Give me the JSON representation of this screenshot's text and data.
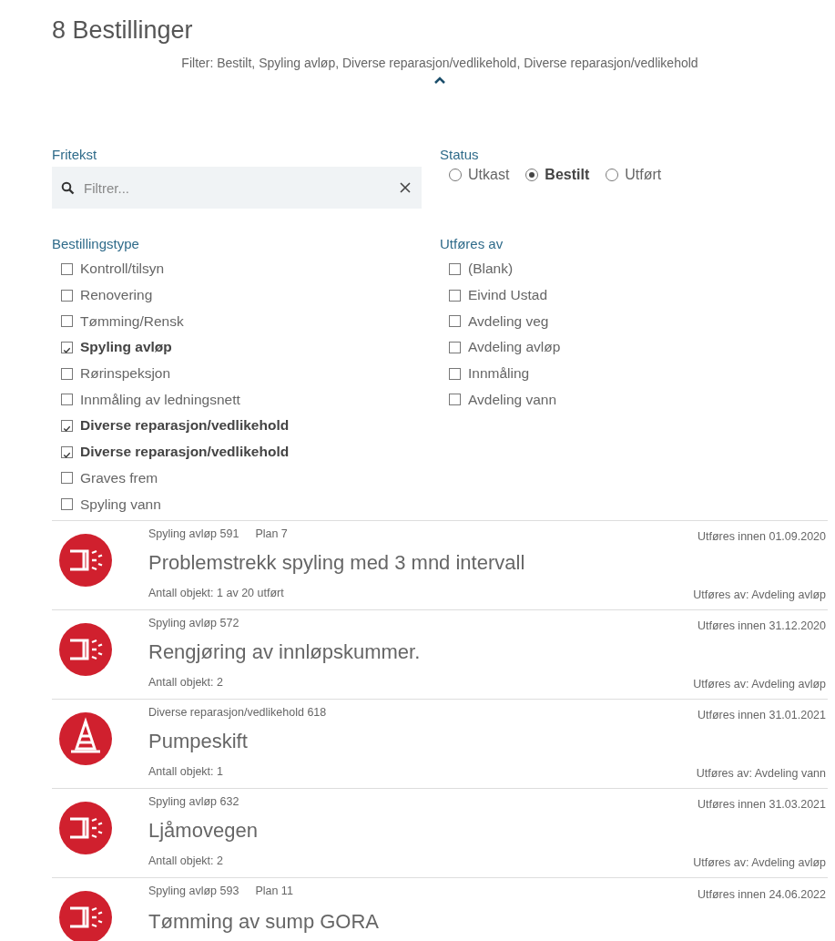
{
  "header": {
    "title": "8 Bestillinger",
    "filter_summary": "Filter: Bestilt, Spyling avløp, Diverse reparasjon/vedlikehold, Diverse reparasjon/vedlikehold",
    "expanded": true
  },
  "search": {
    "label": "Fritekst",
    "placeholder": "Filtrer..."
  },
  "status": {
    "label": "Status",
    "options": [
      {
        "label": "Utkast",
        "selected": false
      },
      {
        "label": "Bestilt",
        "selected": true
      },
      {
        "label": "Utført",
        "selected": false
      }
    ]
  },
  "order_types": {
    "label": "Bestillingstype",
    "items": [
      {
        "label": "Kontroll/tilsyn",
        "checked": false
      },
      {
        "label": "Renovering",
        "checked": false
      },
      {
        "label": "Tømming/Rensk",
        "checked": false
      },
      {
        "label": "Spyling avløp",
        "checked": true
      },
      {
        "label": "Rørinspeksjon",
        "checked": false
      },
      {
        "label": "Innmåling av ledningsnett",
        "checked": false
      },
      {
        "label": "Diverse reparasjon/vedlikehold",
        "checked": true
      },
      {
        "label": "Diverse reparasjon/vedlikehold",
        "checked": true
      },
      {
        "label": "Graves frem",
        "checked": false
      },
      {
        "label": "Spyling vann",
        "checked": false
      }
    ]
  },
  "performed_by": {
    "label": "Utføres av",
    "items": [
      {
        "label": "(Blank)",
        "checked": false
      },
      {
        "label": "Eivind Ustad",
        "checked": false
      },
      {
        "label": "Avdeling veg",
        "checked": false
      },
      {
        "label": "Avdeling avløp",
        "checked": false
      },
      {
        "label": "Innmåling",
        "checked": false
      },
      {
        "label": "Avdeling vann",
        "checked": false
      }
    ]
  },
  "orders": [
    {
      "kind": "flush",
      "type_number": "Spyling avløp 591",
      "plan": "Plan 7",
      "due": "Utføres innen 01.09.2020",
      "title": "Problemstrekk spyling med 3 mnd intervall",
      "count": "Antall objekt: 1 av 20 utført",
      "performer": "Utføres av: Avdeling avløp"
    },
    {
      "kind": "flush",
      "type_number": "Spyling avløp 572",
      "due": "Utføres innen 31.12.2020",
      "title": "Rengjøring av innløpskummer.",
      "count": "Antall objekt: 2",
      "performer": "Utføres av: Avdeling avløp"
    },
    {
      "kind": "cone",
      "type_number": "Diverse reparasjon/vedlikehold 618",
      "due": "Utføres innen 31.01.2021",
      "title": "Pumpeskift",
      "count": "Antall objekt: 1",
      "performer": "Utføres av: Avdeling vann"
    },
    {
      "kind": "flush",
      "type_number": "Spyling avløp 632",
      "due": "Utføres innen 31.03.2021",
      "title": "Ljåmovegen",
      "count": "Antall objekt: 2",
      "performer": "Utføres av: Avdeling avløp"
    },
    {
      "kind": "flush",
      "type_number": "Spyling avløp 593",
      "plan": "Plan 11",
      "due": "Utføres innen 24.06.2022",
      "title": "Tømming av sump GORA"
    }
  ]
}
